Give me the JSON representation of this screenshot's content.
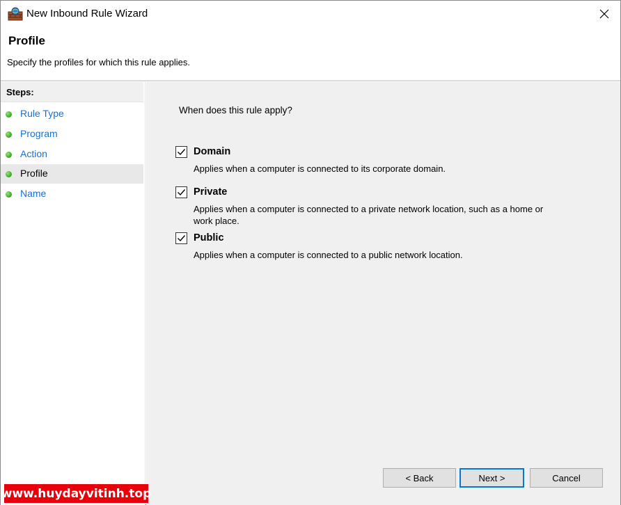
{
  "window": {
    "title": "New Inbound Rule Wizard",
    "icon": "firewall-wall-icon"
  },
  "header": {
    "title": "Profile",
    "description": "Specify the profiles for which this rule applies."
  },
  "steps": {
    "title": "Steps:",
    "items": [
      {
        "label": "Rule Type",
        "current": false
      },
      {
        "label": "Program",
        "current": false
      },
      {
        "label": "Action",
        "current": false
      },
      {
        "label": "Profile",
        "current": true
      },
      {
        "label": "Name",
        "current": false
      }
    ]
  },
  "main": {
    "question": "When does this rule apply?",
    "options": [
      {
        "label": "Domain",
        "checked": true,
        "description": "Applies when a computer is connected to its corporate domain."
      },
      {
        "label": "Private",
        "checked": true,
        "description": "Applies when a computer is connected to a private network location, such as a home or work place."
      },
      {
        "label": "Public",
        "checked": true,
        "description": "Applies when a computer is connected to a public network location."
      }
    ]
  },
  "buttons": {
    "back": "< Back",
    "next": "Next >",
    "cancel": "Cancel"
  },
  "watermark": "www.huydayvitinh.top",
  "colors": {
    "link": "#1a6fd4",
    "step_dot": "#3fae2a",
    "accent": "#0078d7",
    "watermark_bg": "#e8000b"
  }
}
